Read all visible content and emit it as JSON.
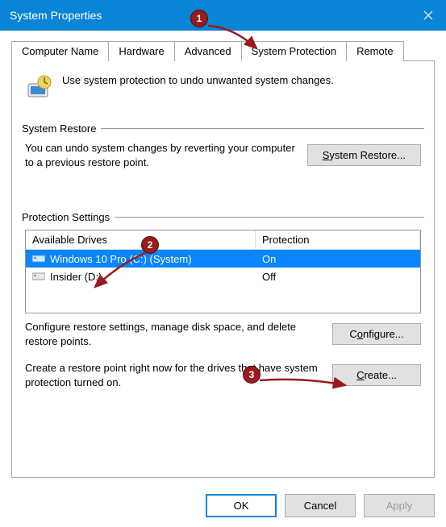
{
  "window": {
    "title": "System Properties"
  },
  "tabs": {
    "computer_name": "Computer Name",
    "hardware": "Hardware",
    "advanced": "Advanced",
    "system_protection": "System Protection",
    "remote": "Remote"
  },
  "intro_text": "Use system protection to undo unwanted system changes.",
  "group_restore": {
    "title": "System Restore",
    "text": "You can undo system changes by reverting your computer to a previous restore point.",
    "button": "System Restore..."
  },
  "group_protection": {
    "title": "Protection Settings",
    "col_drives": "Available Drives",
    "col_protection": "Protection",
    "drives": [
      {
        "name": "Windows 10 Pro (C:) (System)",
        "protection": "On",
        "selected": true
      },
      {
        "name": "Insider (D:)",
        "protection": "Off",
        "selected": false
      }
    ],
    "configure_text": "Configure restore settings, manage disk space, and delete restore points.",
    "configure_button": "Configure...",
    "create_text": "Create a restore point right now for the drives that have system protection turned on.",
    "create_button": "Create..."
  },
  "dialog_buttons": {
    "ok": "OK",
    "cancel": "Cancel",
    "apply": "Apply"
  },
  "annotations": {
    "b1": "1",
    "b2": "2",
    "b3": "3"
  }
}
